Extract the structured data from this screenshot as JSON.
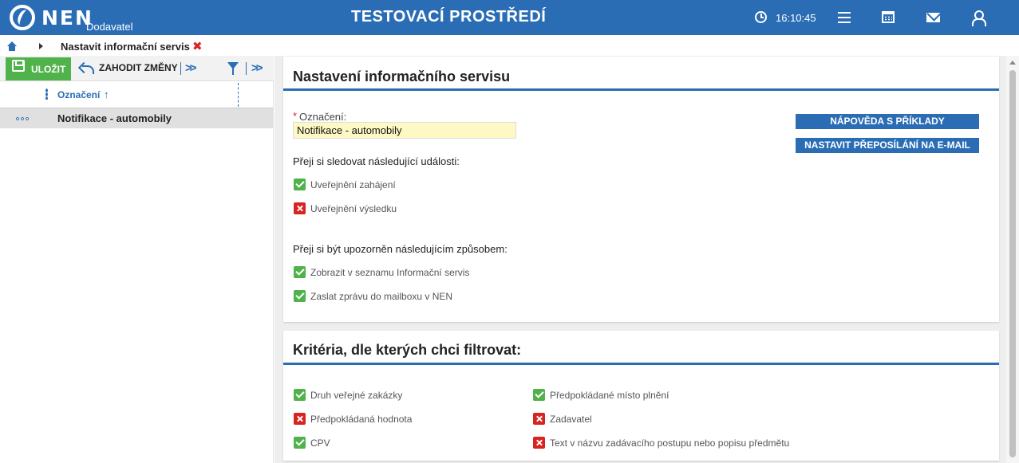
{
  "header": {
    "logo": "NEN",
    "logo_sub": "Dodavatel",
    "environment": "TESTOVACÍ PROSTŘEDÍ",
    "clock": "16:10:45",
    "brand_color": "#2a6db5"
  },
  "breadcrumb": {
    "current": "Nastavit informační servis",
    "close_glyph": "✖"
  },
  "toolbar": {
    "save_label": "ULOŽIT",
    "discard_label": "ZAHODIT ZMĚNY"
  },
  "list": {
    "column_label": "Označení",
    "sort_glyph": "↑",
    "rows": [
      {
        "label": "Notifikace - automobily"
      }
    ]
  },
  "settings": {
    "title": "Nastavení informačního servisu",
    "field_label": "Označení:",
    "field_value": "Notifikace - automobily",
    "help_button": "NÁPOVĚDA S PŘÍKLADY",
    "forward_button": "NASTAVIT PŘEPOSÍLÁNÍ NA E-MAIL",
    "events_heading": "Přeji si sledovat následující události:",
    "events": [
      {
        "label": "Uveřejnění zahájení",
        "checked": true
      },
      {
        "label": "Uveřejnění výsledku",
        "checked": false
      }
    ],
    "notify_heading": "Přeji si být upozorněn následujícím způsobem:",
    "notify": [
      {
        "label": "Zobrazit v seznamu Informační servis",
        "checked": true
      },
      {
        "label": "Zaslat zprávu do mailboxu v NEN",
        "checked": true
      }
    ]
  },
  "criteria": {
    "title": "Kritéria, dle kterých chci filtrovat:",
    "left": [
      {
        "label": "Druh veřejné zakázky",
        "checked": true
      },
      {
        "label": "Předpokládaná hodnota",
        "checked": false
      },
      {
        "label": "CPV",
        "checked": true
      }
    ],
    "right": [
      {
        "label": "Předpokládané místo plnění",
        "checked": true
      },
      {
        "label": "Zadavatel",
        "checked": false
      },
      {
        "label": "Text v názvu zadávacího postupu nebo popisu předmětu",
        "checked": false
      }
    ]
  }
}
